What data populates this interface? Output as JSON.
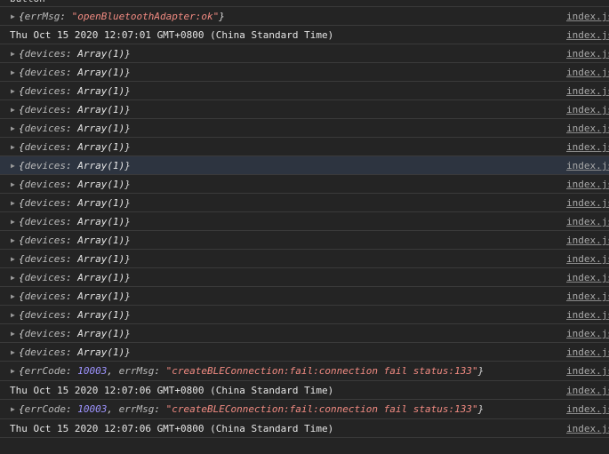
{
  "top_partial": "button",
  "source_link": "index.js",
  "rows": [
    {
      "type": "object",
      "key1": "errMsg",
      "val1": "\"openBluetoothAdapter:ok\""
    },
    {
      "type": "text",
      "text": "Thu Oct 15 2020 12:07:01 GMT+0800 (China Standard Time)"
    },
    {
      "type": "devices",
      "key": "devices",
      "val": "Array(1)"
    },
    {
      "type": "devices",
      "key": "devices",
      "val": "Array(1)"
    },
    {
      "type": "devices",
      "key": "devices",
      "val": "Array(1)"
    },
    {
      "type": "devices",
      "key": "devices",
      "val": "Array(1)"
    },
    {
      "type": "devices",
      "key": "devices",
      "val": "Array(1)"
    },
    {
      "type": "devices",
      "key": "devices",
      "val": "Array(1)"
    },
    {
      "type": "devices",
      "key": "devices",
      "val": "Array(1)"
    },
    {
      "type": "devices",
      "key": "devices",
      "val": "Array(1)"
    },
    {
      "type": "devices",
      "key": "devices",
      "val": "Array(1)"
    },
    {
      "type": "devices",
      "key": "devices",
      "val": "Array(1)"
    },
    {
      "type": "devices",
      "key": "devices",
      "val": "Array(1)"
    },
    {
      "type": "devices",
      "key": "devices",
      "val": "Array(1)"
    },
    {
      "type": "devices",
      "key": "devices",
      "val": "Array(1)"
    },
    {
      "type": "devices",
      "key": "devices",
      "val": "Array(1)"
    },
    {
      "type": "devices",
      "key": "devices",
      "val": "Array(1)"
    },
    {
      "type": "devices",
      "key": "devices",
      "val": "Array(1)"
    },
    {
      "type": "devices",
      "key": "devices",
      "val": "Array(1)"
    },
    {
      "type": "error",
      "code_key": "errCode",
      "code_val": "10003",
      "msg_key": "errMsg",
      "msg_val": "\"createBLEConnection:fail:connection fail status:133\""
    },
    {
      "type": "text",
      "text": "Thu Oct 15 2020 12:07:06 GMT+0800 (China Standard Time)"
    },
    {
      "type": "error",
      "code_key": "errCode",
      "code_val": "10003",
      "msg_key": "errMsg",
      "msg_val": "\"createBLEConnection:fail:connection fail status:133\""
    },
    {
      "type": "text",
      "text": "Thu Oct 15 2020 12:07:06 GMT+0800 (China Standard Time)"
    }
  ],
  "colors": {
    "background": "#242424",
    "string": "#f28b82",
    "number": "#9e94ff",
    "highlight_row": "#2d3440"
  },
  "icons": {
    "expand": "triangle-right-icon"
  }
}
